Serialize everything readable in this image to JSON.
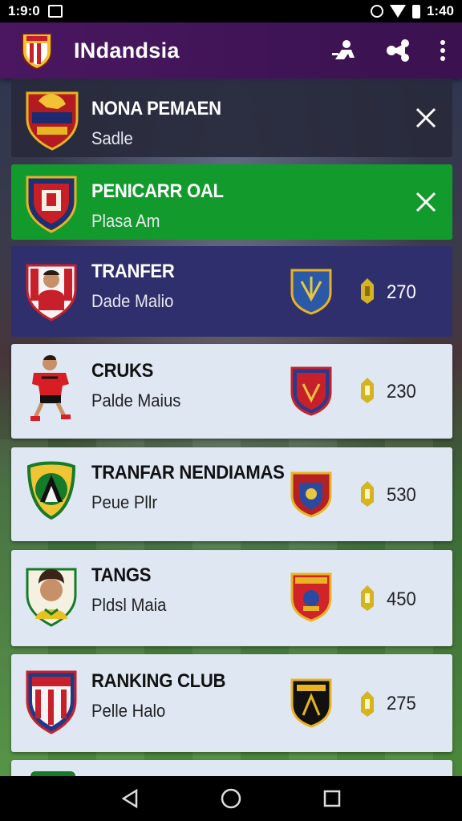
{
  "status_bar": {
    "time": "1:9:0",
    "clock_right": "1:40"
  },
  "app_bar": {
    "title": "INdandsia"
  },
  "cards": [
    {
      "title": "NONA PEMAEN",
      "subtitle": "Sadle",
      "style": "dark",
      "dismissible": true
    },
    {
      "title": "PENICARR OAL",
      "subtitle": "Plasa Am",
      "style": "green",
      "dismissible": true
    },
    {
      "title": "TRANFER",
      "subtitle": "Dade Malio",
      "style": "navy",
      "points": "270"
    },
    {
      "title": "CRUKS",
      "subtitle": "Palde Maius",
      "style": "light",
      "points": "230"
    },
    {
      "title": "TRANFAR NENDIAMAS",
      "subtitle": "Peue Pllr",
      "style": "light",
      "points": "530"
    },
    {
      "title": "TANGS",
      "subtitle": "Pldsl Maia",
      "style": "light",
      "points": "450"
    },
    {
      "title": "RANKING CLUB",
      "subtitle": "Pelle Halo",
      "style": "light",
      "points": "275"
    }
  ],
  "colors": {
    "app_bar": "#4a1760",
    "green_card": "#139a2c",
    "navy_card": "#2f2f6e",
    "light_card": "#dfe7f3",
    "coin": "#d4b421"
  },
  "icons": {
    "header_actions": [
      "person-add-icon",
      "share-icon",
      "more-vert-icon"
    ],
    "nav": [
      "back-icon",
      "home-icon",
      "recents-icon"
    ]
  }
}
